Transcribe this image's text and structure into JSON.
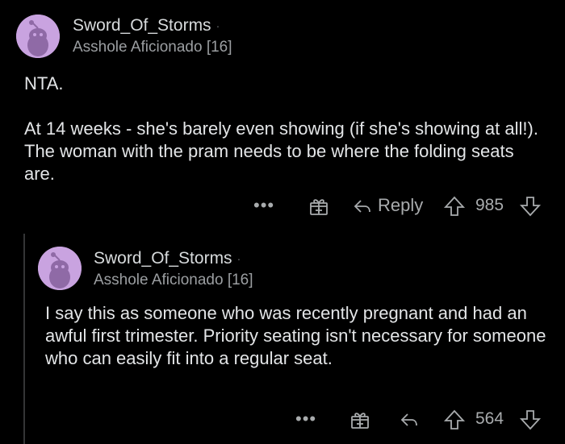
{
  "comments": [
    {
      "username": "Sword_Of_Storms",
      "flair": "Asshole Aficionado [16]",
      "paragraphs": [
        "NTA.",
        "At 14 weeks - she's barely even showing (if she's showing at all!). The woman with the pram needs to be where the folding seats are."
      ],
      "actions": {
        "more": "•••",
        "reply_label": "Reply",
        "score": "985"
      }
    },
    {
      "username": "Sword_Of_Storms",
      "flair": "Asshole Aficionado [16]",
      "paragraphs": [
        "I say this as someone who was recently pregnant and had an awful first trimester. Priority seating isn't necessary for someone who can easily fit into a regular seat."
      ],
      "actions": {
        "more": "•••",
        "score": "564"
      }
    }
  ],
  "icons": {
    "avatar": "snoo-avatar-icon",
    "gift": "gift-award-icon",
    "reply": "reply-arrow-icon",
    "upvote": "upvote-arrow-icon",
    "downvote": "downvote-arrow-icon"
  },
  "colors": {
    "background": "#000000",
    "text": "#e3e5e7",
    "muted": "#9b9ea1",
    "avatar_bg": "#c9a3e0"
  }
}
